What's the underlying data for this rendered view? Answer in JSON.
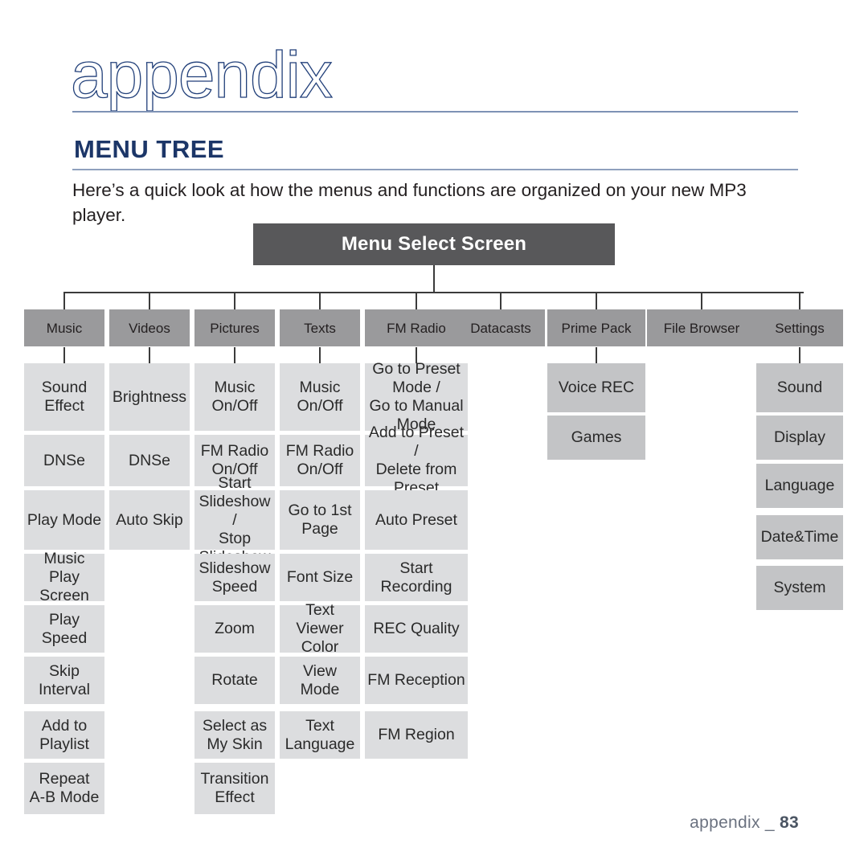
{
  "page": {
    "chapter_title": "appendix",
    "section_heading": "MENU TREE",
    "intro": "Here’s a quick look at how the menus and functions are organized on your new MP3 player.",
    "footer_label": "appendix _",
    "footer_page": "83"
  },
  "colors": {
    "heading_navy": "#1c3668",
    "root_bar": "#58585a",
    "category_box": "#9a9a9c",
    "sub_box": "#dcdddf",
    "sub_box_dark": "#c3c4c6",
    "rule": "#8fa0bd",
    "connector": "#3b3b3b",
    "footer_text": "#6b7280"
  },
  "tree": {
    "root": "Menu Select Screen",
    "columns": [
      {
        "name": "Music",
        "items": [
          "Sound\nEffect",
          "DNSe",
          "Play Mode",
          "Music Play\nScreen",
          "Play\nSpeed",
          "Skip\nInterval",
          "Add to\nPlaylist",
          "Repeat\nA-B Mode"
        ]
      },
      {
        "name": "Videos",
        "items": [
          "Brightness",
          "DNSe",
          "Auto Skip"
        ]
      },
      {
        "name": "Pictures",
        "items": [
          "Music\nOn/Off",
          "FM Radio\nOn/Off",
          "Start\nSlideshow /\nStop\nSlideshow",
          "Slideshow\nSpeed",
          "Zoom",
          "Rotate",
          "Select as\nMy Skin",
          "Transition\nEffect"
        ]
      },
      {
        "name": "Texts",
        "items": [
          "Music\nOn/Off",
          "FM Radio\nOn/Off",
          "Go to 1st\nPage",
          "Font Size",
          "Text Viewer\nColor",
          "View Mode",
          "Text\nLanguage"
        ]
      },
      {
        "name": "FM Radio",
        "items": [
          "Go to Preset\nMode /\nGo to Manual\nMode",
          "Add to Preset /\nDelete from\nPreset",
          "Auto Preset",
          "Start\nRecording",
          "REC Quality",
          "FM Reception",
          "FM Region"
        ]
      },
      {
        "name": "Datacasts",
        "items": []
      },
      {
        "name": "Prime Pack",
        "items": [
          "Voice REC",
          "Games"
        ]
      },
      {
        "name": "File Browser",
        "items": []
      },
      {
        "name": "Settings",
        "items": [
          "Sound",
          "Display",
          "Language",
          "Date&Time",
          "System"
        ]
      }
    ]
  }
}
